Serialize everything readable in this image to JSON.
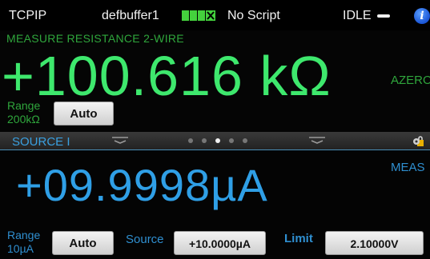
{
  "status_bar": {
    "interface": "TCPIP",
    "buffer_name": "defbuffer1",
    "script": "No Script",
    "state": "IDLE",
    "buffer_fill_fraction": 0.85,
    "icons": {
      "info": "info-icon",
      "state_indicator": "idle-bar-icon"
    }
  },
  "measure": {
    "title": "MEASURE RESISTANCE 2-WIRE",
    "reading": "+100.616 kΩ",
    "azero_label": "AZERO",
    "range_label": "Range",
    "range_value": "200kΩ",
    "range_button": "Auto"
  },
  "swipe": {
    "title": "SOURCE I",
    "page_count": 5,
    "active_page": 3
  },
  "source": {
    "meas_label": "MEAS",
    "reading": "+09.9998µA",
    "range_label": "Range",
    "range_value": "10µA",
    "range_button": "Auto",
    "source_label": "Source",
    "source_value": "+10.0000µA",
    "limit_label": "Limit",
    "limit_value": "2.10000V"
  },
  "colors": {
    "measure_accent": "#3ee86d",
    "source_accent": "#2f9fe6",
    "buffer_gauge": "#44d13d",
    "background": "#050505"
  }
}
